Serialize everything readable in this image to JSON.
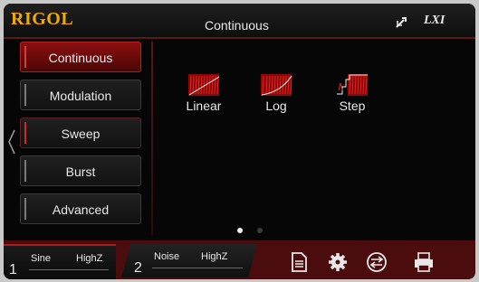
{
  "header": {
    "logo": "RIGOL",
    "title": "Continuous",
    "lxi_label": "LXI",
    "usb_icon": "usb-icon"
  },
  "menu": {
    "items": [
      {
        "label": "Continuous",
        "state": "active"
      },
      {
        "label": "Modulation",
        "state": "normal"
      },
      {
        "label": "Sweep",
        "state": "current"
      },
      {
        "label": "Burst",
        "state": "normal"
      },
      {
        "label": "Advanced",
        "state": "normal"
      }
    ]
  },
  "sweep_types": [
    {
      "label": "Linear",
      "icon": "linear-sweep-icon"
    },
    {
      "label": "Log",
      "icon": "log-sweep-icon"
    },
    {
      "label": "Step",
      "icon": "step-sweep-icon"
    }
  ],
  "pager": {
    "pages": 2,
    "active": 1
  },
  "channels": [
    {
      "number": "1",
      "waveform": "Sine",
      "impedance": "HighZ"
    },
    {
      "number": "2",
      "waveform": "Noise",
      "impedance": "HighZ"
    }
  ],
  "toolbar_icons": [
    "file-icon",
    "settings-gear-icon",
    "channel-switch-icon",
    "printer-icon"
  ],
  "colors": {
    "accent": "#b01a1a",
    "logo": "#f2a900",
    "background": "#060606"
  }
}
